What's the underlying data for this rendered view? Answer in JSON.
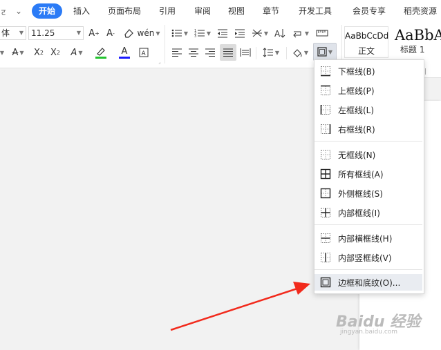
{
  "menubar": {
    "lead_undo": "ट",
    "lead_dropdown": "⌄",
    "tabs": [
      "开始",
      "插入",
      "页面布局",
      "引用",
      "审阅",
      "视图",
      "章节",
      "开发工具",
      "会员专享",
      "稻壳资源"
    ]
  },
  "ribbon": {
    "font_name": "体",
    "font_size": "11.25",
    "styles": [
      {
        "preview": "AaBbCcDd",
        "name": "正文"
      },
      {
        "preview": "AaBbA",
        "name": "标题 1"
      }
    ],
    "colors": {
      "highlight": "#22c32e",
      "font_color": "#1a1aff",
      "accent": "#2b7bf6"
    }
  },
  "border_menu": {
    "groups": [
      [
        "下框线(B)",
        "上框线(P)",
        "左框线(L)",
        "右框线(R)"
      ],
      [
        "无框线(N)",
        "所有框线(A)",
        "外侧框线(S)",
        "内部框线(I)"
      ],
      [
        "内部横框线(H)",
        "内部竖框线(V)"
      ],
      [
        "边框和底纹(O)..."
      ]
    ]
  },
  "watermark": {
    "brand": "Baidu 经验",
    "url": "jingyan.baidu.com"
  }
}
